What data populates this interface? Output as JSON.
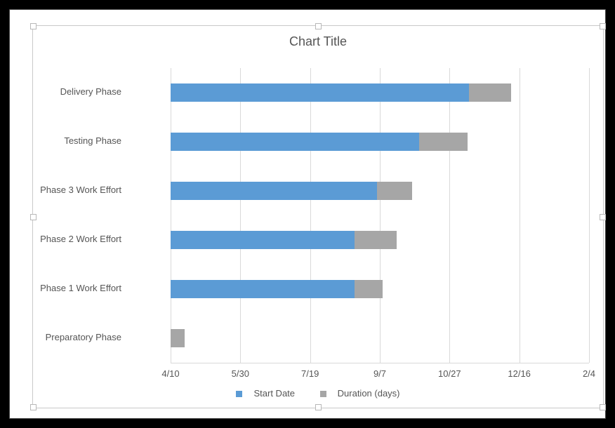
{
  "chart_data": {
    "type": "bar",
    "orientation": "horizontal_stacked",
    "title": "Chart Title",
    "categories": [
      "Preparatory Phase",
      "Phase 1 Work Effort",
      "Phase 2 Work Effort",
      "Phase 3 Work Effort",
      "Testing Phase",
      "Delivery Phase"
    ],
    "series": [
      {
        "name": "Start Date",
        "color": "#5b9bd5",
        "values_label": [
          "4/10",
          "8/20",
          "8/20",
          "9/5",
          "10/5",
          "11/10"
        ],
        "values": [
          0,
          132,
          132,
          148,
          178,
          214
        ]
      },
      {
        "name": "Duration (days)",
        "color": "#a6a6a6",
        "values": [
          10,
          20,
          30,
          25,
          35,
          30
        ]
      }
    ],
    "xaxis": {
      "ticks_label": [
        "4/10",
        "5/30",
        "7/19",
        "9/7",
        "10/27",
        "12/16",
        "2/4"
      ],
      "ticks_value": [
        0,
        50,
        100,
        150,
        200,
        250,
        300
      ],
      "range": [
        0,
        300
      ]
    },
    "legend_position": "bottom"
  }
}
